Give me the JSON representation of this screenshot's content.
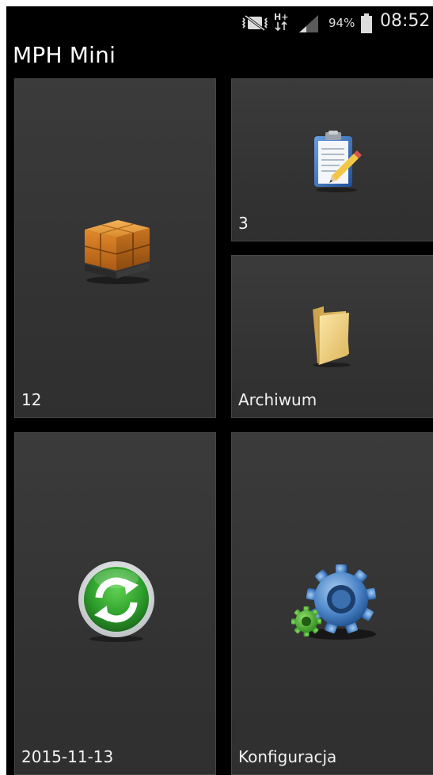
{
  "status_bar": {
    "battery_percent": "94%",
    "time": "08:52",
    "network_type": "H+",
    "icons": [
      "vibrate-mute-icon",
      "network-data-icon",
      "signal-icon",
      "battery-icon"
    ]
  },
  "app": {
    "title": "MPH Mini"
  },
  "tiles": [
    {
      "label": "12",
      "icon": "pallet-boxes-icon"
    },
    {
      "label": "3",
      "icon": "clipboard-icon"
    },
    {
      "label": "Archiwum",
      "icon": "folder-icon"
    },
    {
      "label": "2015-11-13",
      "icon": "sync-icon"
    },
    {
      "label": "Konfiguracja",
      "icon": "gears-icon"
    }
  ],
  "colors": {
    "background": "#000000",
    "tile": "#353535",
    "text": "#ffffff"
  }
}
